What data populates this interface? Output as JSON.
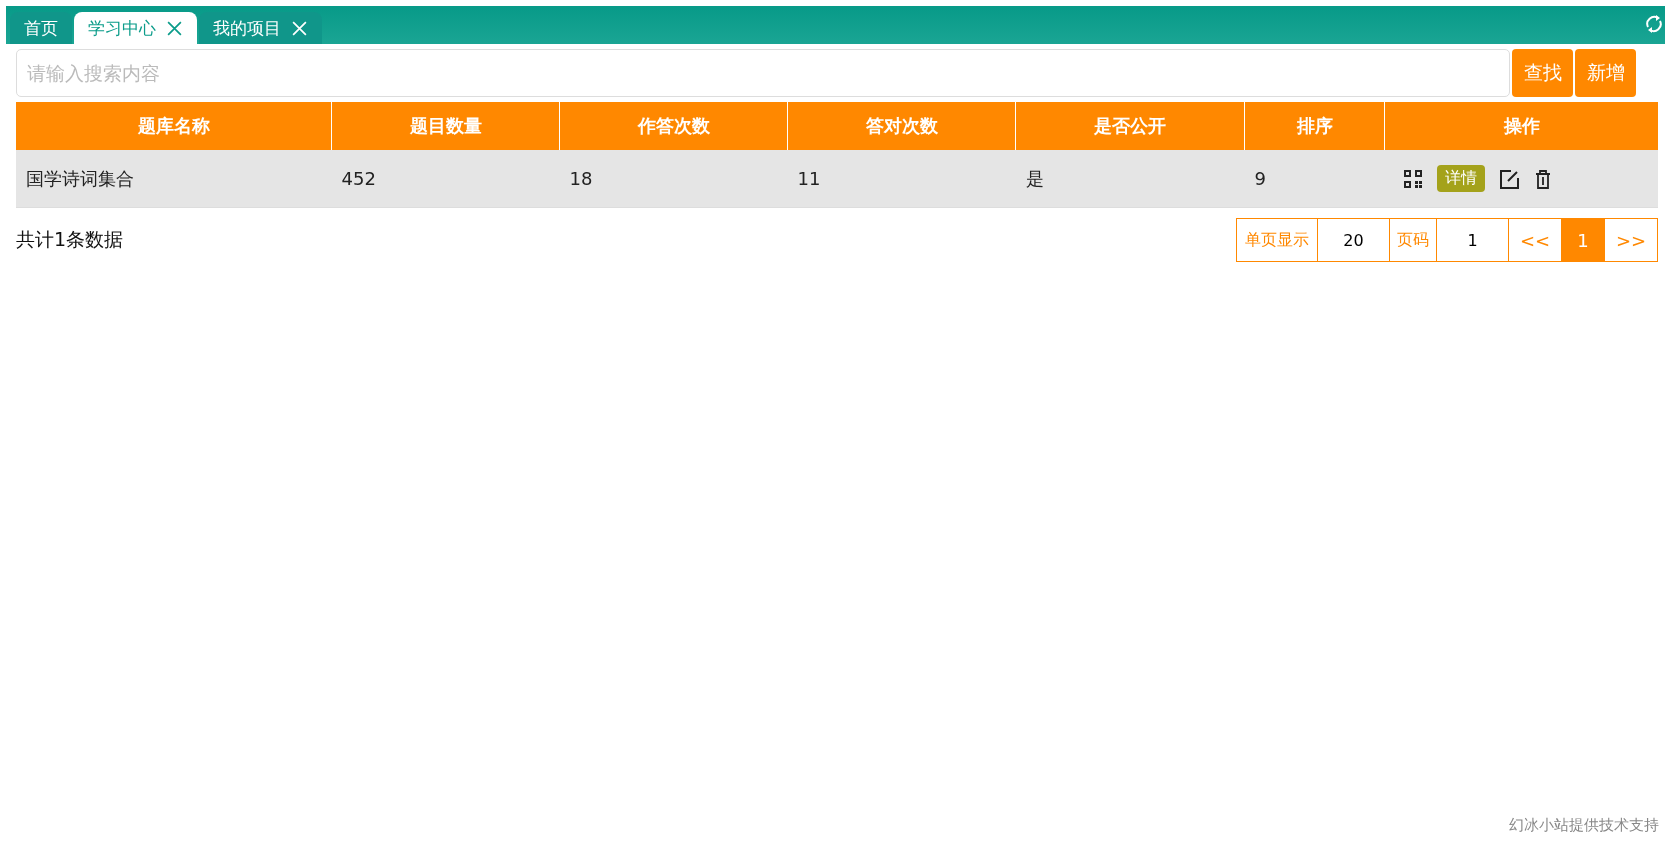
{
  "tabs": [
    {
      "label": "首页",
      "selected": false,
      "closable": false
    },
    {
      "label": "学习中心",
      "selected": true,
      "closable": true
    },
    {
      "label": "我的项目",
      "selected": false,
      "closable": true
    }
  ],
  "search": {
    "placeholder": "请输入搜索内容"
  },
  "buttons": [
    "查找",
    "新增"
  ],
  "table": {
    "columns": [
      "题库名称",
      "题目数量",
      "作答次数",
      "答对次数",
      "是否公开",
      "排序",
      "操作"
    ],
    "rows": [
      {
        "cells": [
          "国学诗词集合",
          "452",
          "18",
          "11",
          "是",
          "9"
        ],
        "detail_button": "详情"
      }
    ]
  },
  "total": "共计1条数据",
  "pagination": {
    "page_size_label": "单页显示",
    "page_size": "20",
    "page_label": "页码",
    "page_input": "1",
    "prev": "<<",
    "next": ">>",
    "pages": [
      {
        "label": "1",
        "selected": true
      }
    ]
  },
  "footer": "幻冰小站提供技术支持"
}
